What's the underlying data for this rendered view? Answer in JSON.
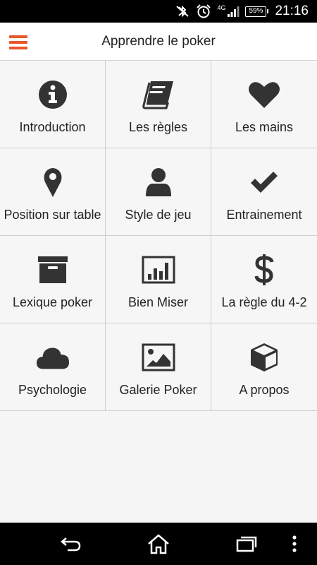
{
  "status_bar": {
    "network": "4G",
    "battery": "59%",
    "time": "21:16",
    "icons": [
      "bluetooth-off-icon",
      "alarm-icon",
      "signal-icon",
      "battery-icon"
    ]
  },
  "app_bar": {
    "title": "Apprendre le poker",
    "menu_icon": "hamburger-menu-icon",
    "accent_color": "#e8572a"
  },
  "menu_grid": {
    "items": [
      {
        "label": "Introduction",
        "icon": "info-icon"
      },
      {
        "label": "Les règles",
        "icon": "book-icon"
      },
      {
        "label": "Les mains",
        "icon": "heart-icon"
      },
      {
        "label": "Position sur table",
        "icon": "map-marker-icon"
      },
      {
        "label": "Style de jeu",
        "icon": "user-icon"
      },
      {
        "label": "Entrainement",
        "icon": "check-icon"
      },
      {
        "label": "Lexique poker",
        "icon": "archive-box-icon"
      },
      {
        "label": "Bien Miser",
        "icon": "bar-chart-icon"
      },
      {
        "label": "La règle du 4-2",
        "icon": "dollar-icon"
      },
      {
        "label": "Psychologie",
        "icon": "cloud-icon"
      },
      {
        "label": "Galerie Poker",
        "icon": "image-icon"
      },
      {
        "label": "A propos",
        "icon": "cube-icon"
      }
    ]
  },
  "nav_bar": {
    "buttons": [
      "back-icon",
      "home-icon",
      "recent-apps-icon",
      "overflow-menu-icon"
    ]
  }
}
